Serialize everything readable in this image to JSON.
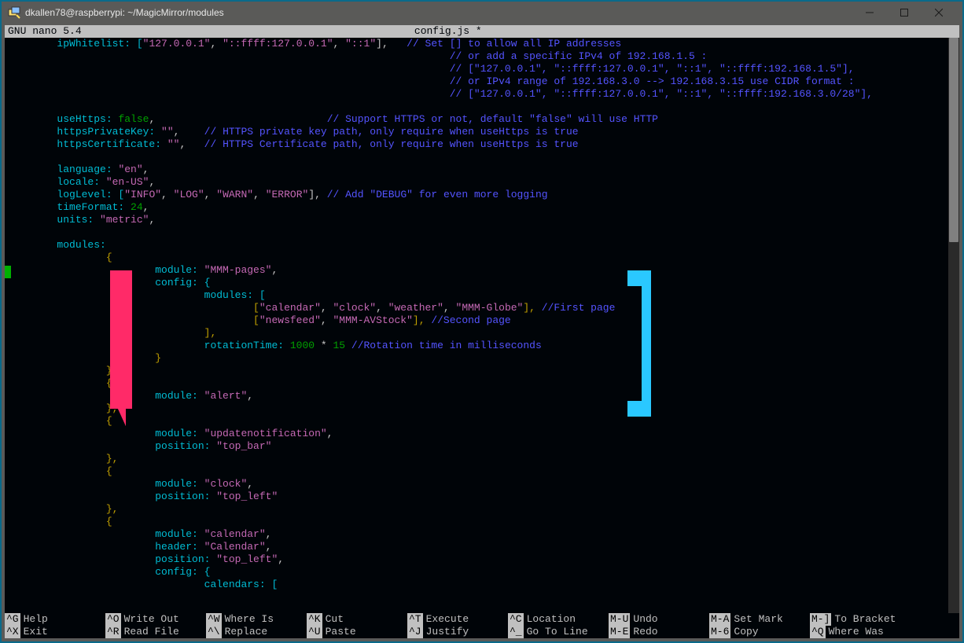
{
  "window": {
    "title": "dkallen78@raspberrypi: ~/MagicMirror/modules"
  },
  "nano": {
    "version": "GNU nano  5.4",
    "filename": "config.js *"
  },
  "code": {
    "l1a": "        ipWhitelist: [",
    "l1b": "\"127.0.0.1\"",
    "l1c": ", ",
    "l1d": "\"::ffff:127.0.0.1\"",
    "l1e": ", ",
    "l1f": "\"::1\"",
    "l1g": "],   ",
    "l1h": "// Set [] to allow all IP addresses",
    "l2": "                                                                        // or add a specific IPv4 of 192.168.1.5 :",
    "l3": "                                                                        // [\"127.0.0.1\", \"::ffff:127.0.0.1\", \"::1\", \"::ffff:192.168.1.5\"],",
    "l4": "                                                                        // or IPv4 range of 192.168.3.0 --> 192.168.3.15 use CIDR format :",
    "l5": "                                                                        // [\"127.0.0.1\", \"::ffff:127.0.0.1\", \"::1\", \"::ffff:192.168.3.0/28\"],",
    "l6a": "        useHttps: ",
    "l6b": "false",
    "l6c": ",                            ",
    "l6d": "// Support HTTPS or not, default \"false\" will use HTTP",
    "l7a": "        httpsPrivateKey: ",
    "l7b": "\"\"",
    "l7c": ",    ",
    "l7d": "// HTTPS private key path, only require when useHttps is true",
    "l8a": "        httpsCertificate: ",
    "l8b": "\"\"",
    "l8c": ",   ",
    "l8d": "// HTTPS Certificate path, only require when useHttps is true",
    "l9a": "        language: ",
    "l9b": "\"en\"",
    "l9c": ",",
    "l10a": "        locale: ",
    "l10b": "\"en-US\"",
    "l10c": ",",
    "l11a": "        logLevel: [",
    "l11b": "\"INFO\"",
    "l11c": ", ",
    "l11d": "\"LOG\"",
    "l11e": ", ",
    "l11f": "\"WARN\"",
    "l11g": ", ",
    "l11h": "\"ERROR\"",
    "l11i": "], ",
    "l11j": "// Add \"DEBUG\" for even more logging",
    "l12a": "        timeFormat: ",
    "l12b": "24",
    "l12c": ",",
    "l13a": "        units: ",
    "l13b": "\"metric\"",
    "l13c": ",",
    "l14": "        modules: ",
    "l15": "                {",
    "l16a": "                        module: ",
    "l16b": "\"MMM-pages\"",
    "l16c": ",",
    "l17": "                        config: {",
    "l18": "                                modules: [",
    "l19a": "                                        [",
    "l19b": "\"calendar\"",
    "l19c": ", ",
    "l19d": "\"clock\"",
    "l19e": ", ",
    "l19f": "\"weather\"",
    "l19g": ", ",
    "l19h": "\"MMM-Globe\"",
    "l19i": "], ",
    "l19j": "//First page",
    "l20a": "                                        [",
    "l20b": "\"newsfeed\"",
    "l20c": ", ",
    "l20d": "\"MMM-AVStock\"",
    "l20e": "], ",
    "l20f": "//Second page",
    "l21": "                                ],",
    "l22a": "                                rotationTime: ",
    "l22b": "1000",
    "l22c": " * ",
    "l22d": "15",
    "l22e": " ",
    "l22f": "//Rotation time in milliseconds",
    "l23": "                        }",
    "l24": "                },",
    "l25": "                {",
    "l26a": "                        module: ",
    "l26b": "\"alert\"",
    "l26c": ",",
    "l27": "                },",
    "l28": "                {",
    "l29a": "                        module: ",
    "l29b": "\"updatenotification\"",
    "l29c": ",",
    "l30a": "                        position: ",
    "l30b": "\"top_bar\"",
    "l31": "                },",
    "l32": "                {",
    "l33a": "                        module: ",
    "l33b": "\"clock\"",
    "l33c": ",",
    "l34a": "                        position: ",
    "l34b": "\"top_left\"",
    "l35": "                },",
    "l36": "                {",
    "l37a": "                        module: ",
    "l37b": "\"calendar\"",
    "l37c": ",",
    "l38a": "                        header: ",
    "l38b": "\"Calendar\"",
    "l38c": ",",
    "l39a": "                        position: ",
    "l39b": "\"top_left\"",
    "l39c": ",",
    "l40": "                        config: {",
    "l41": "                                calendars: ["
  },
  "footer": {
    "r1": [
      {
        "k": "^G",
        "l": "Help"
      },
      {
        "k": "^O",
        "l": "Write Out"
      },
      {
        "k": "^W",
        "l": "Where Is"
      },
      {
        "k": "^K",
        "l": "Cut"
      },
      {
        "k": "^T",
        "l": "Execute"
      },
      {
        "k": "^C",
        "l": "Location"
      },
      {
        "k": "M-U",
        "l": "Undo"
      },
      {
        "k": "M-A",
        "l": "Set Mark"
      },
      {
        "k": "M-]",
        "l": "To Bracket"
      }
    ],
    "r2": [
      {
        "k": "^X",
        "l": "Exit"
      },
      {
        "k": "^R",
        "l": "Read File"
      },
      {
        "k": "^\\",
        "l": "Replace"
      },
      {
        "k": "^U",
        "l": "Paste"
      },
      {
        "k": "^J",
        "l": "Justify"
      },
      {
        "k": "^_",
        "l": "Go To Line"
      },
      {
        "k": "M-E",
        "l": "Redo"
      },
      {
        "k": "M-6",
        "l": "Copy"
      },
      {
        "k": "^Q",
        "l": "Where Was"
      }
    ]
  },
  "annotations": {
    "left_bracket_color": "#ff2a68",
    "right_bracket_color": "#2ac8ff"
  }
}
